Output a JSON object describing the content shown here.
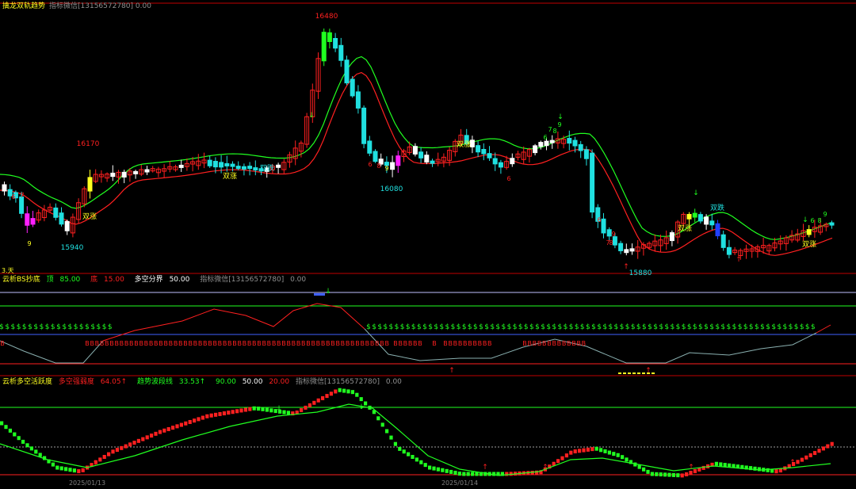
{
  "colors": {
    "background": "#000000",
    "up": "#ff2020",
    "down": "#20e0e0",
    "yellow": "#ffff20",
    "magenta": "#ff20ff",
    "green": "#20ff20",
    "white": "#ffffff",
    "blue": "#2040ff",
    "gray": "#909090",
    "panelLine": "#c00000"
  },
  "panel1": {
    "title": "擒龙双轨趋势",
    "tag": "指标微信[13156572780] 0.00",
    "price_labels": {
      "high": "16480",
      "low1": "15940",
      "low2": "16080",
      "low3": "15880",
      "peak": "16170"
    },
    "double_rise": "双涨",
    "double_fall": "双跌",
    "side_label": "3.天"
  },
  "panel2": {
    "title": "云析BS抄底",
    "items": [
      {
        "label": "顶",
        "value": "85.00",
        "color": "#20ff20"
      },
      {
        "label": "底",
        "value": "15.00",
        "color": "#ff2020"
      },
      {
        "label": "多空分界",
        "value": "50.00",
        "color": "#ffffff"
      },
      {
        "label": "指标微信[13156572780]",
        "value": "0.00",
        "color": "#909090"
      }
    ],
    "dollar": "$",
    "b_mark": "B"
  },
  "panel3": {
    "title": "云析多空活跃度",
    "items": [
      {
        "label": "多空强弱度",
        "value": "64.05↑",
        "color": "#ff2020"
      },
      {
        "label": "趋势波段线",
        "value": "33.53↑",
        "color": "#20ff20"
      },
      {
        "label": "",
        "value": "90.00",
        "color": "#20ff20"
      },
      {
        "label": "",
        "value": "50.00",
        "color": "#ffffff"
      },
      {
        "label": "",
        "value": "20.00",
        "color": "#ff2020"
      },
      {
        "label": "指标微信[13156572780]",
        "value": "0.00",
        "color": "#909090"
      }
    ],
    "dates": [
      "2025/01/13",
      "2025/01/14"
    ]
  },
  "chart_data": [
    {
      "type": "candlestick",
      "title": "擒龙双轨趋势",
      "annotations": [
        "16480",
        "16170",
        "15940",
        "16080",
        "15880",
        "双涨",
        "双跌"
      ],
      "ylim": [
        15850,
        16500
      ]
    },
    {
      "type": "line",
      "title": "云析BS抄底",
      "levels": [
        85,
        15,
        50
      ],
      "ylim": [
        0,
        100
      ]
    },
    {
      "type": "line",
      "title": "云析多空活跃度",
      "levels": [
        90,
        50,
        20
      ],
      "ylim": [
        0,
        100
      ],
      "x_ticks": [
        "2025/01/13",
        "2025/01/14"
      ]
    }
  ]
}
